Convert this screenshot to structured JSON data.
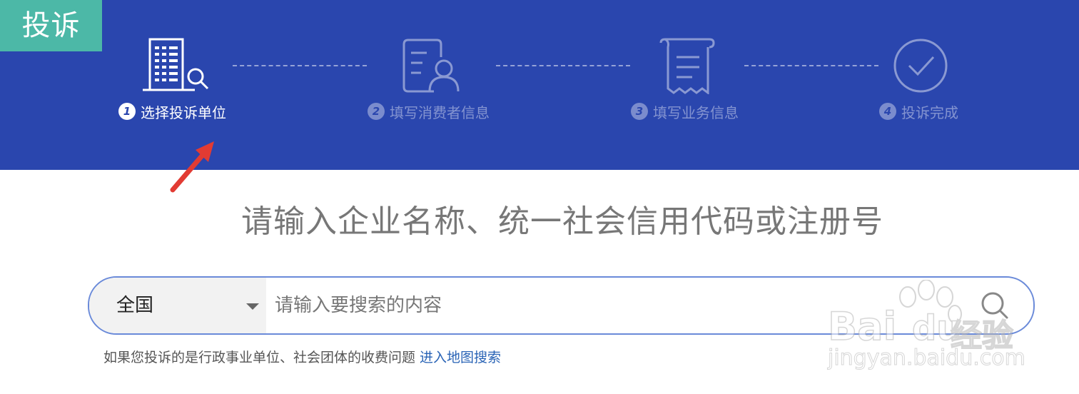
{
  "badge": {
    "label": "投诉"
  },
  "steps": [
    {
      "number": "1",
      "label": "选择投诉单位",
      "active": true,
      "icon": "building-search-icon"
    },
    {
      "number": "2",
      "label": "填写消费者信息",
      "active": false,
      "icon": "person-card-icon"
    },
    {
      "number": "3",
      "label": "填写业务信息",
      "active": false,
      "icon": "receipt-icon"
    },
    {
      "number": "4",
      "label": "投诉完成",
      "active": false,
      "icon": "check-circle-icon"
    }
  ],
  "heading": "请输入企业名称、统一社会信用代码或注册号",
  "search": {
    "region": "全国",
    "placeholder": "请输入要搜索的内容",
    "value": ""
  },
  "hint": {
    "text": "如果您投诉的是行政事业单位、社会团体的收费问题",
    "link": "进入地图搜索"
  },
  "watermark": {
    "line1": "Bai",
    "line1b": "du",
    "line1c": "经验",
    "line2": "jingyan.baidu.com"
  },
  "colors": {
    "banner": "#2a46ae",
    "badge": "#4cb8a7",
    "search_border": "#6a8ad9",
    "link": "#2a64b6",
    "arrow": "#e23b33"
  }
}
